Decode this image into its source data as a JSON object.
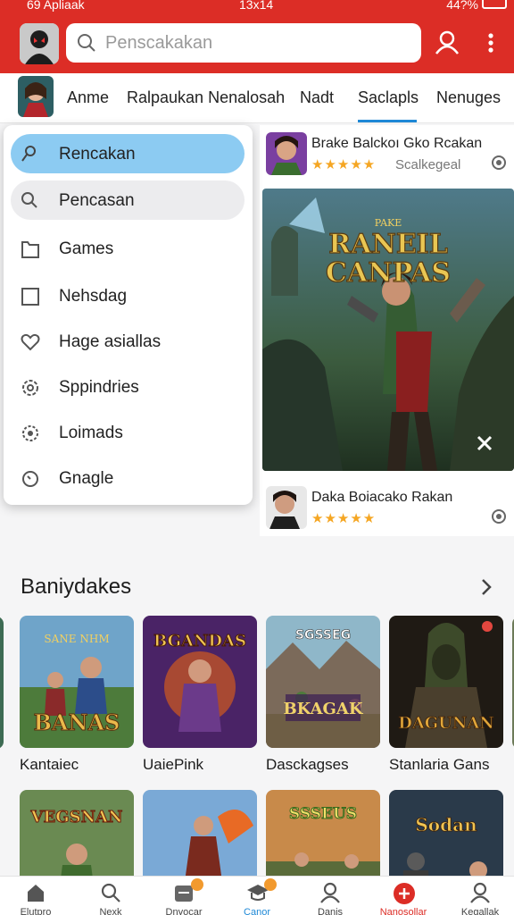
{
  "status_bar": {
    "left": "69 Apliaak",
    "center": "13x14",
    "right": "44?%"
  },
  "header": {
    "search_placeholder": "Penscakakan",
    "avatar_icon": "user-avatar",
    "accent_color": "#dc2d26"
  },
  "tabs": {
    "items": [
      {
        "label": "Anme"
      },
      {
        "label": "Ralpaukan Nenalosah"
      },
      {
        "label": "Nadt"
      },
      {
        "label": "Saclapls"
      },
      {
        "label": "Nenuges"
      }
    ],
    "active_index": 3,
    "active_color": "#1e88d6"
  },
  "menu": {
    "items": [
      {
        "label": "Rencakan",
        "icon": "pin-icon"
      },
      {
        "label": "Pencasan",
        "icon": "search-icon"
      },
      {
        "label": "Games",
        "icon": "folder-icon"
      },
      {
        "label": "Nehsdag",
        "icon": "square-icon"
      },
      {
        "label": "Hage asiallas",
        "icon": "heart-icon"
      },
      {
        "label": "Sppindries",
        "icon": "gear-icon"
      },
      {
        "label": "Loimads",
        "icon": "settings-icon"
      },
      {
        "label": "Gnagle",
        "icon": "clock-icon"
      }
    ],
    "active_index": 0
  },
  "featured": {
    "top": {
      "title": "Brake Balckoı Gko Rcakan",
      "rating": "★★★★★",
      "subtitle": "Scalkegeal"
    },
    "banner": {
      "title_line1": "RANEIL",
      "title_line2": "CANPAS",
      "tag": "PAKE"
    },
    "bottom": {
      "title": "Daka Boiacako Rakan",
      "rating": "★★★★★"
    }
  },
  "section": {
    "title": "Baniydakes",
    "tiles_row1": [
      {
        "label": "Kantaiec",
        "art_text": "BANAS"
      },
      {
        "label": "UaiePink",
        "art_text": "BGANDAS"
      },
      {
        "label": "Dasckagses",
        "art_text": "BKAGAK"
      },
      {
        "label": "Stanlaria Gans",
        "art_text": "DAGUNAN"
      }
    ],
    "tiles_row2": [
      {
        "art_text": "VEGSNAN"
      },
      {
        "art_text": ""
      },
      {
        "art_text": "SSSEUS"
      },
      {
        "art_text": "Sodan"
      }
    ]
  },
  "bottom_nav": {
    "items": [
      {
        "label": "Elutpro",
        "icon": "home-icon"
      },
      {
        "label": "Nexk",
        "icon": "search-icon"
      },
      {
        "label": "Dnyocar",
        "icon": "box-icon"
      },
      {
        "label": "Canor",
        "icon": "graduation-icon"
      },
      {
        "label": "Danis",
        "icon": "person-icon"
      },
      {
        "label": "Nanosollar",
        "icon": "plus-circle-icon"
      },
      {
        "label": "Kegallak",
        "icon": "profile-icon"
      }
    ],
    "active_index": 3,
    "active_color": "#1e88d6",
    "highlight_color": "#dc2d26"
  }
}
